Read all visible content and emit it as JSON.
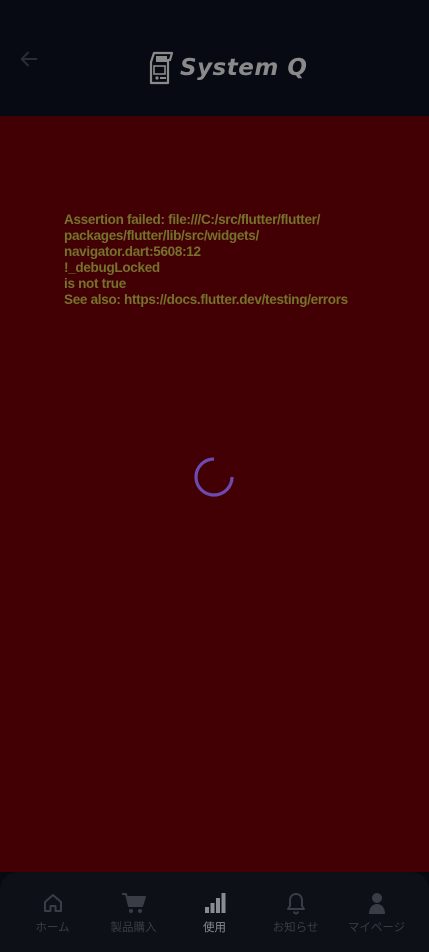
{
  "header": {
    "back_icon": "arrow-left-icon",
    "logo_icon": "arcade-machine-icon",
    "logo_text": "System Q"
  },
  "error": {
    "lines": [
      "Assertion failed: file:///C:/src/flutter/flutter/",
      "packages/flutter/lib/src/widgets/",
      "navigator.dart:5608:12",
      "!_debugLocked",
      "is not true",
      "See also: https://docs.flutter.dev/testing/errors"
    ],
    "text_color": "#76722c",
    "background_color": "#420005"
  },
  "loading": {
    "icon": "loading-spinner-icon",
    "color": "#6c4ab0"
  },
  "bottom_nav": {
    "items": [
      {
        "label": "ホーム",
        "icon": "home-icon",
        "active": false
      },
      {
        "label": "製品購入",
        "icon": "cart-icon",
        "active": false
      },
      {
        "label": "使用",
        "icon": "bar-chart-icon",
        "active": true
      },
      {
        "label": "お知らせ",
        "icon": "bell-icon",
        "active": false
      },
      {
        "label": "マイページ",
        "icon": "person-icon",
        "active": false
      }
    ]
  }
}
